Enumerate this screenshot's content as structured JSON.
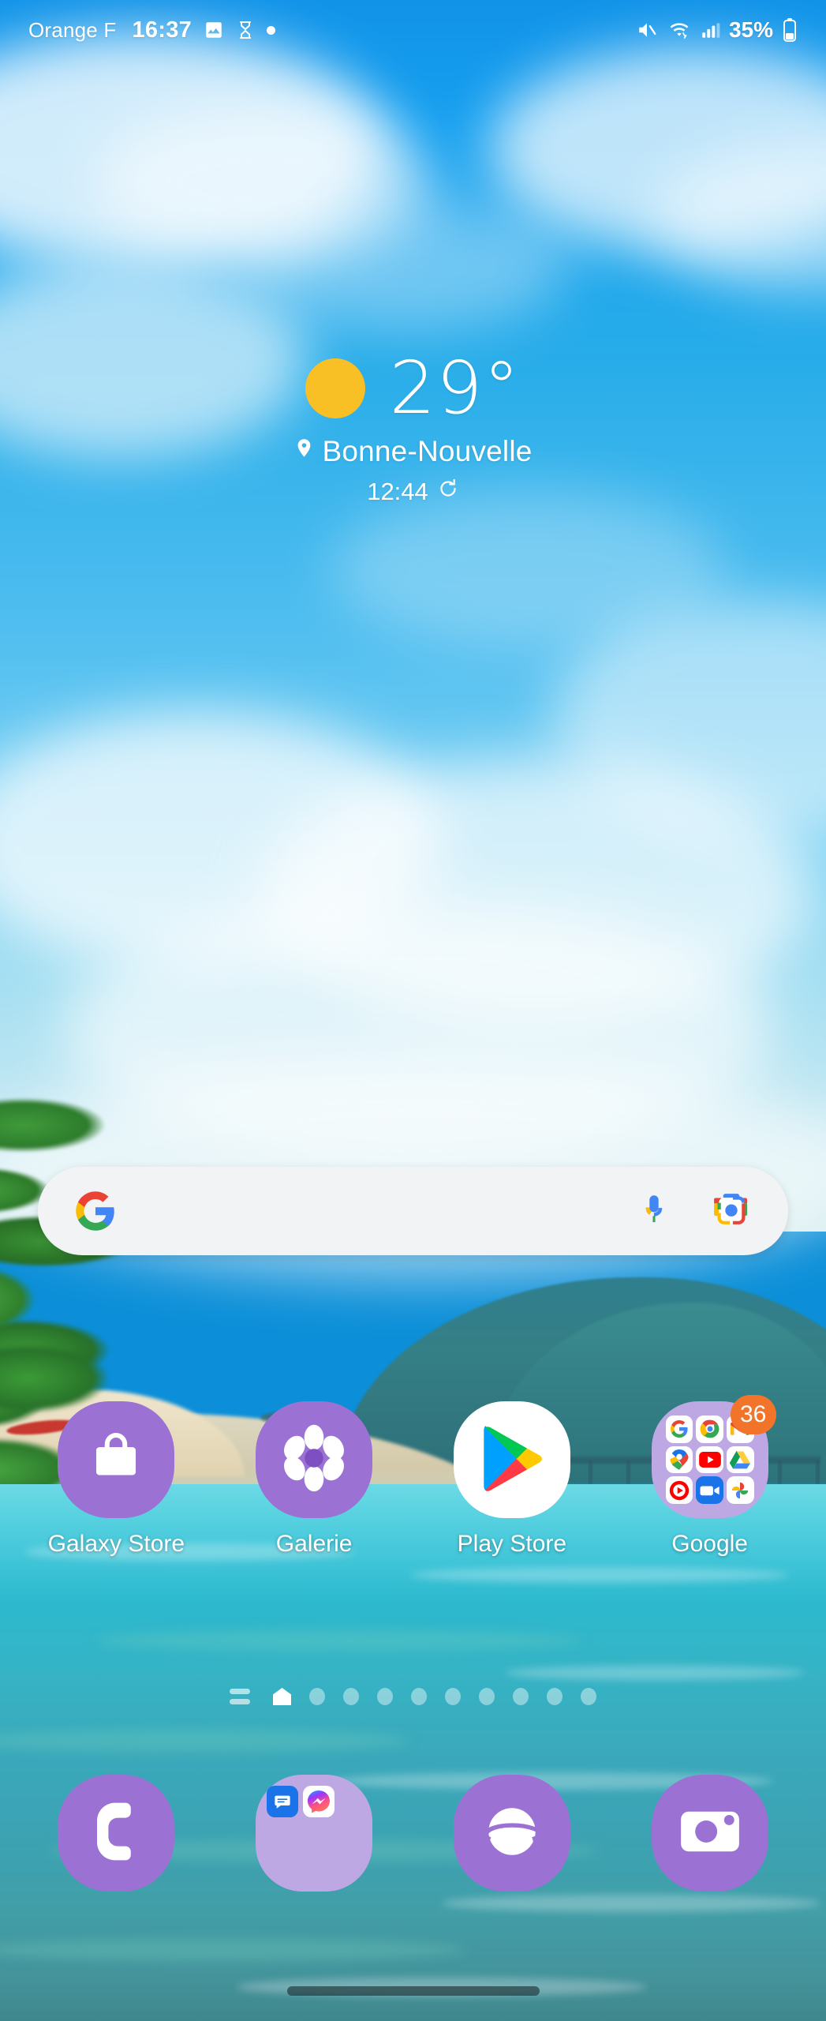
{
  "status_bar": {
    "carrier": "Orange F",
    "time": "16:37",
    "notification_icons": [
      "image-icon",
      "hourglass-icon",
      "dot-icon"
    ],
    "mute_icon": "volume-mute-icon",
    "wifi_icon": "wifi-icon",
    "signal_icon": "cellular-signal-icon",
    "battery_percent": "35%",
    "battery_icon": "battery-icon"
  },
  "weather_widget": {
    "condition_icon": "sun-icon",
    "temperature": "29°",
    "location_icon": "location-pin-icon",
    "location": "Bonne-Nouvelle",
    "updated_time": "12:44",
    "refresh_icon": "refresh-icon"
  },
  "search_bar": {
    "google_icon": "google-g-icon",
    "query": "",
    "placeholder": "",
    "mic_icon": "microphone-icon",
    "lens_icon": "google-lens-icon"
  },
  "app_grid": [
    {
      "label": "Galaxy Store",
      "icon": "shopping-bag-icon",
      "type": "app",
      "bg": "#9b72d4"
    },
    {
      "label": "Galerie",
      "icon": "flower-icon",
      "type": "app",
      "bg": "#9b72d4"
    },
    {
      "label": "Play Store",
      "icon": "play-store-icon",
      "type": "app",
      "bg": "#ffffff"
    },
    {
      "label": "Google",
      "icon": "folder-icon",
      "type": "folder",
      "bg": "#bda8e3",
      "badge": "36",
      "contents": [
        "Google",
        "Chrome",
        "Gmail",
        "Maps",
        "YouTube",
        "Drive",
        "YT Music",
        "Meet",
        "Photos"
      ]
    }
  ],
  "page_indicator": {
    "menu_icon": "page-list-icon",
    "home_icon": "home-page-icon",
    "total_pages": 10,
    "active_page": 1
  },
  "dock": [
    {
      "label": "Phone",
      "icon": "phone-icon",
      "type": "app"
    },
    {
      "label": "Messages",
      "icon": "folder-icon",
      "type": "folder",
      "contents": [
        "Messages",
        "Messenger"
      ]
    },
    {
      "label": "Internet",
      "icon": "internet-icon",
      "type": "app"
    },
    {
      "label": "Camera",
      "icon": "camera-icon",
      "type": "app"
    }
  ],
  "nav_bar": {
    "gesture_handle": "gesture-pill"
  },
  "colors": {
    "samsung_purple": "#9b72d4",
    "folder_lavender": "#bda8e3",
    "badge_orange": "#f2742a",
    "sun_yellow": "#f9c026",
    "search_bg": "#f2f3f4"
  }
}
